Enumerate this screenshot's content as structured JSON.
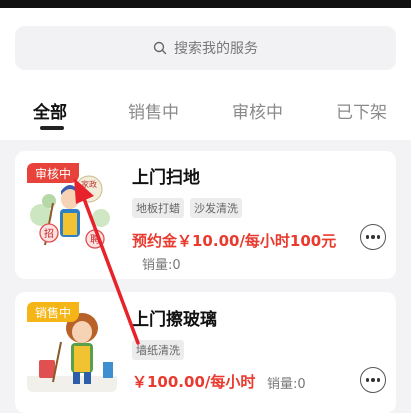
{
  "search": {
    "placeholder": "搜索我的服务",
    "icon": "search-icon"
  },
  "tabs": [
    {
      "label": "全部",
      "active": true
    },
    {
      "label": "销售中",
      "active": false
    },
    {
      "label": "审核中",
      "active": false
    },
    {
      "label": "已下架",
      "active": false
    }
  ],
  "services": [
    {
      "badge": "审核中",
      "badge_color": "#e8433a",
      "title": "上门扫地",
      "tags": [
        "地板打蜡",
        "沙发清洗"
      ],
      "price": "预约金￥10.00/每小时100元",
      "sales": "销量:0",
      "thumb_text": {
        "top": "家政",
        "left": "招",
        "right": "聘"
      }
    },
    {
      "badge": "销售中",
      "badge_color": "#f5b516",
      "title": "上门擦玻璃",
      "tags": [
        "墙纸清洗"
      ],
      "price": "￥100.00/每小时",
      "sales": "销量:0"
    }
  ],
  "colors": {
    "price": "#e83a2f",
    "annotation_arrow": "#e8222a"
  }
}
